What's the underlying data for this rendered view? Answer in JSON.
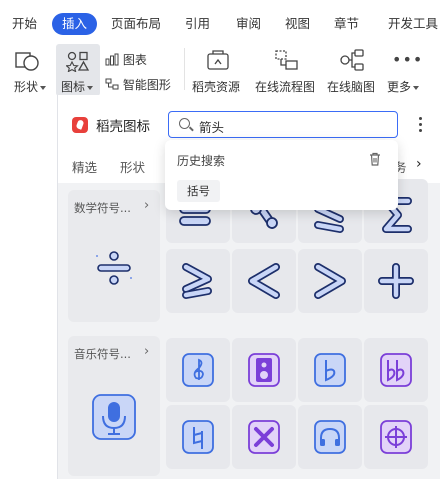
{
  "ribbon": {
    "tabs": [
      {
        "label": "开始",
        "active": false
      },
      {
        "label": "插入",
        "active": true
      },
      {
        "label": "页面布局",
        "active": false
      },
      {
        "label": "引用",
        "active": false
      },
      {
        "label": "审阅",
        "active": false
      },
      {
        "label": "视图",
        "active": false
      },
      {
        "label": "章节",
        "active": false
      },
      {
        "label": "开发工具",
        "active": false
      }
    ],
    "accent": "#2b62e6"
  },
  "toolbar": {
    "shape_label": "形状",
    "icons_label": "图标",
    "chart_label": "图表",
    "smart_shape_label": "智能图形",
    "daoke_resources_label": "稻壳资源",
    "online_flowchart_label": "在线流程图",
    "online_mindmap_label": "在线脑图",
    "more_label": "更多"
  },
  "pane": {
    "title": "稻壳图标",
    "search": {
      "value": "箭头"
    },
    "categories": [
      "精选",
      "形状",
      "务"
    ],
    "history_popup": {
      "title": "历史搜索",
      "items": [
        "括号"
      ]
    },
    "sections": [
      {
        "title": "数学符号...",
        "preview_icon": "divide-icon",
        "icons": [
          "equals-icon",
          "percent-icon",
          "less-equal-icon",
          "sigma-icon",
          "greater-equal-icon",
          "less-than-icon",
          "greater-than-icon",
          "plus-icon"
        ]
      },
      {
        "title": "音乐符号...",
        "preview_icon": "microphone-icon",
        "icons": [
          "treble-clef-icon",
          "speaker-icon",
          "flat-icon",
          "double-flat-icon",
          "natural-icon",
          "double-sharp-icon",
          "headphones-icon",
          "target-icon"
        ]
      }
    ]
  },
  "colors": {
    "icon_blue": "#3f6fe0",
    "icon_fill": "#c9d6f7",
    "icon_purple": "#7b3fd8",
    "icon_purple_fill": "#e2d3f8",
    "search_border": "#3b6cf6",
    "logo_red": "#e8403b"
  }
}
